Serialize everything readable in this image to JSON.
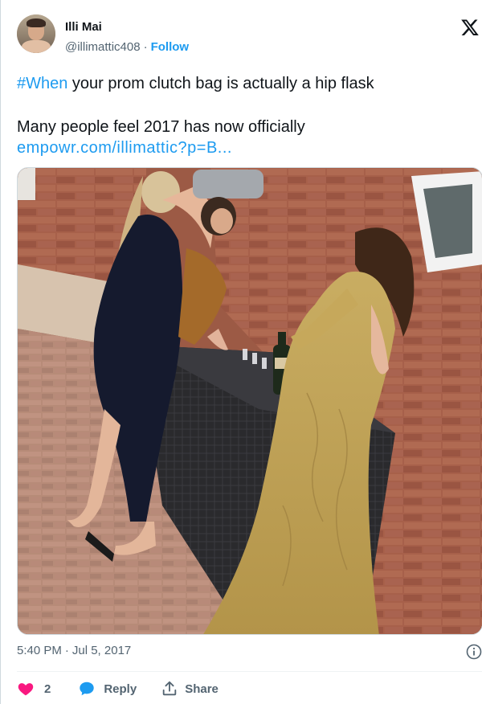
{
  "user": {
    "name": "Illi Mai",
    "handle": "@illimattic408",
    "separator": "·",
    "follow_label": "Follow"
  },
  "tweet": {
    "hashtag": "#When",
    "line1_rest": " your prom clutch bag is actually a hip flask",
    "line2": "Many people feel 2017 has now officially",
    "link": "empowr.com/illimattic?p=B..."
  },
  "meta": {
    "time": "5:40 PM",
    "separator": "·",
    "date": "Jul 5, 2017"
  },
  "actions": {
    "like_count": "2",
    "reply_label": "Reply",
    "share_label": "Share"
  },
  "colors": {
    "accent": "#1d9bf0",
    "like": "#f91880",
    "text": "#0f1419",
    "muted": "#536471"
  },
  "icons": {
    "brand": "x-logo-icon",
    "info": "info-icon",
    "like": "heart-icon",
    "reply": "speech-bubble-icon",
    "share": "share-upload-icon"
  }
}
